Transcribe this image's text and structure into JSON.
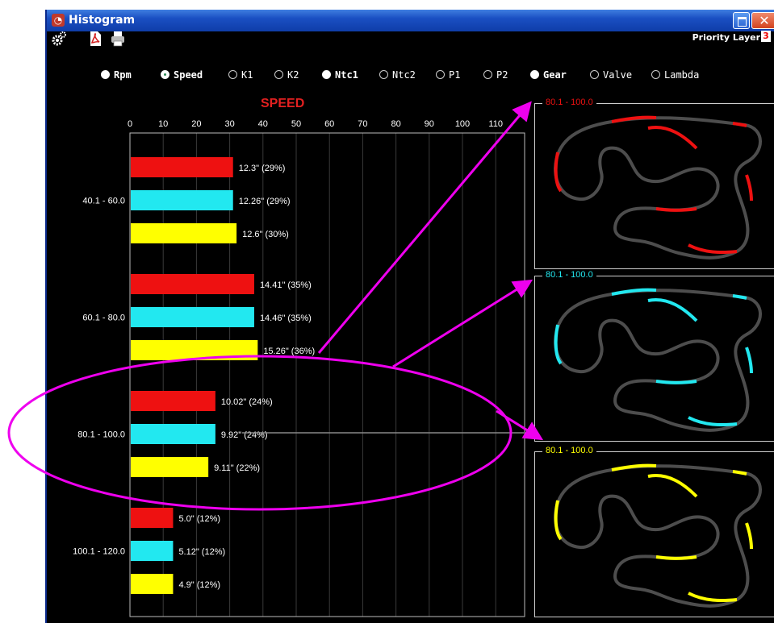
{
  "window": {
    "title": "Histogram"
  },
  "toolbar": {
    "priority_label": "Priority Layer",
    "priority_value": "3",
    "icons": [
      "settings-gears-icon",
      "pdf-icon",
      "printer-icon"
    ]
  },
  "channels": [
    {
      "label": "Rpm",
      "state": "filled"
    },
    {
      "label": "Speed",
      "state": "checked"
    },
    {
      "label": "K1",
      "state": "off"
    },
    {
      "label": "K2",
      "state": "off"
    },
    {
      "label": "Ntc1",
      "state": "filled"
    },
    {
      "label": "Ntc2",
      "state": "off"
    },
    {
      "label": "P1",
      "state": "off"
    },
    {
      "label": "P2",
      "state": "off"
    },
    {
      "label": "Gear",
      "state": "filled"
    },
    {
      "label": "Valve",
      "state": "off"
    },
    {
      "label": "Lambda",
      "state": "off"
    }
  ],
  "chart_data": {
    "type": "bar",
    "orientation": "horizontal",
    "title": "SPEED",
    "xlim": [
      0,
      110
    ],
    "x_ticks": [
      "0",
      "10",
      "20",
      "30",
      "40",
      "50",
      "60",
      "70",
      "80",
      "90",
      "100",
      "110"
    ],
    "categories": [
      "40.1 - 60.0",
      "60.1 - 80.0",
      "80.1 - 100.0",
      "100.1 - 120.0"
    ],
    "series_colors": [
      "#ee1111",
      "#22e8f0",
      "#ffff00"
    ],
    "series": [
      {
        "values": [
          29,
          35,
          24,
          12
        ],
        "labels": [
          "12.3\" (29%)",
          "14.41\" (35%)",
          "10.02\" (24%)",
          "5.0\" (12%)"
        ]
      },
      {
        "values": [
          29,
          35,
          24,
          12
        ],
        "labels": [
          "12.26\" (29%)",
          "14.46\" (35%)",
          "9.92\" (24%)",
          "5.12\" (12%)"
        ]
      },
      {
        "values": [
          30,
          36,
          22,
          12
        ],
        "labels": [
          "12.6\" (30%)",
          "15.26\" (36%)",
          "9.11\" (22%)",
          "4.9\" (12%)"
        ]
      }
    ],
    "grid": true
  },
  "track_panels": [
    {
      "label": "80.1 - 100.0",
      "color": "#ee1111"
    },
    {
      "label": "80.1 - 100.0",
      "color": "#22e8f0"
    },
    {
      "label": "80.1 - 100.0",
      "color": "#ffff00"
    }
  ],
  "annotation_color": "#ee00ee"
}
